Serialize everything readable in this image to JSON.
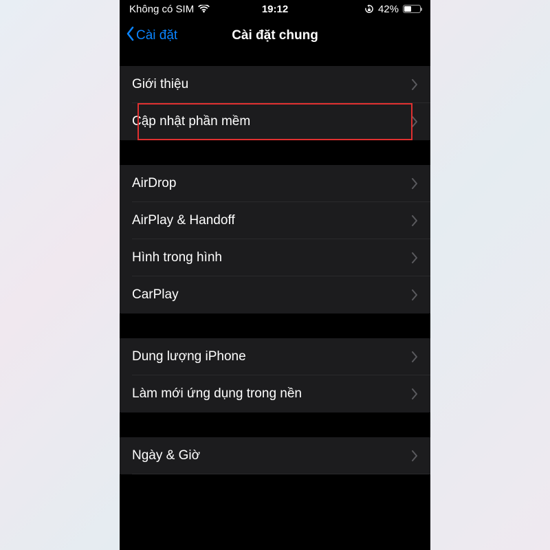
{
  "statusbar": {
    "carrier": "Không có SIM",
    "time": "19:12",
    "battery": "42%"
  },
  "nav": {
    "back": "Cài đặt",
    "title": "Cài đặt chung"
  },
  "groups": [
    {
      "items": [
        {
          "label": "Giới thiệu"
        },
        {
          "label": "Cập nhật phần mềm",
          "highlight": true
        }
      ]
    },
    {
      "items": [
        {
          "label": "AirDrop"
        },
        {
          "label": "AirPlay & Handoff"
        },
        {
          "label": "Hình trong hình"
        },
        {
          "label": "CarPlay"
        }
      ]
    },
    {
      "items": [
        {
          "label": "Dung lượng iPhone"
        },
        {
          "label": "Làm mới ứng dụng trong nền"
        }
      ]
    },
    {
      "items": [
        {
          "label": "Ngày & Giờ"
        }
      ]
    }
  ]
}
